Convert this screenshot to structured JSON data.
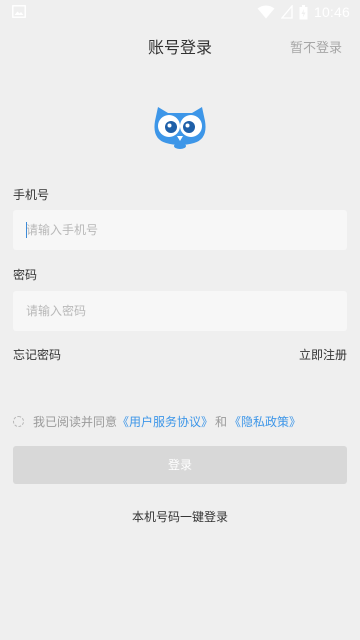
{
  "status_bar": {
    "time": "10:46",
    "icons": [
      "image-icon",
      "wifi-icon",
      "signal-icon",
      "battery-icon"
    ]
  },
  "header": {
    "title": "账号登录",
    "skip_label": "暂不登录"
  },
  "logo": {
    "name": "owl-logo",
    "color": "#3d96e8"
  },
  "form": {
    "phone_label": "手机号",
    "phone_placeholder": "请输入手机号",
    "password_label": "密码",
    "password_placeholder": "请输入密码"
  },
  "links": {
    "forgot_password": "忘记密码",
    "register": "立即注册"
  },
  "agreement": {
    "prefix": "我已阅读并同意",
    "service_link": "《用户服务协议》",
    "and": "和",
    "privacy_link": "《隐私政策》",
    "checked": false
  },
  "login_button": "登录",
  "one_key_login": "本机号码一键登录",
  "colors": {
    "background": "#efefef",
    "accent": "#3d96e8",
    "button_disabled": "#d8d8d8"
  }
}
